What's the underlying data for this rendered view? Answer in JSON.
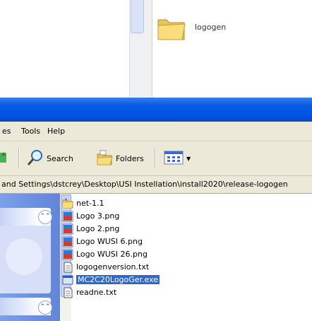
{
  "background_window": {
    "folder_label": "logogen"
  },
  "menu": {
    "items": [
      "es",
      "Tools",
      "Help"
    ]
  },
  "toolbar": {
    "search_label": "Search",
    "folders_label": "Folders"
  },
  "address": {
    "path": "and Settings\\dstcrey\\Desktop\\USI Instellation\\install2020\\release-logogen"
  },
  "files": [
    {
      "name": "net-1.1",
      "type": "folder"
    },
    {
      "name": "Logo 3.png",
      "type": "png"
    },
    {
      "name": "Logo 2.png",
      "type": "png"
    },
    {
      "name": "Logo WUSI 6.png",
      "type": "png"
    },
    {
      "name": "Logo WUSI 26.png",
      "type": "png"
    },
    {
      "name": "logogenversion.txt",
      "type": "txt"
    },
    {
      "name": "MC2C20LogoGer.exe",
      "type": "exe",
      "selected": true
    },
    {
      "name": "readne.txt",
      "type": "txt"
    }
  ],
  "colors": {
    "titlebar": "#0054e3",
    "selection": "#316ac5",
    "taskpane": "#6a8fe0",
    "chrome": "#ece9d8"
  }
}
